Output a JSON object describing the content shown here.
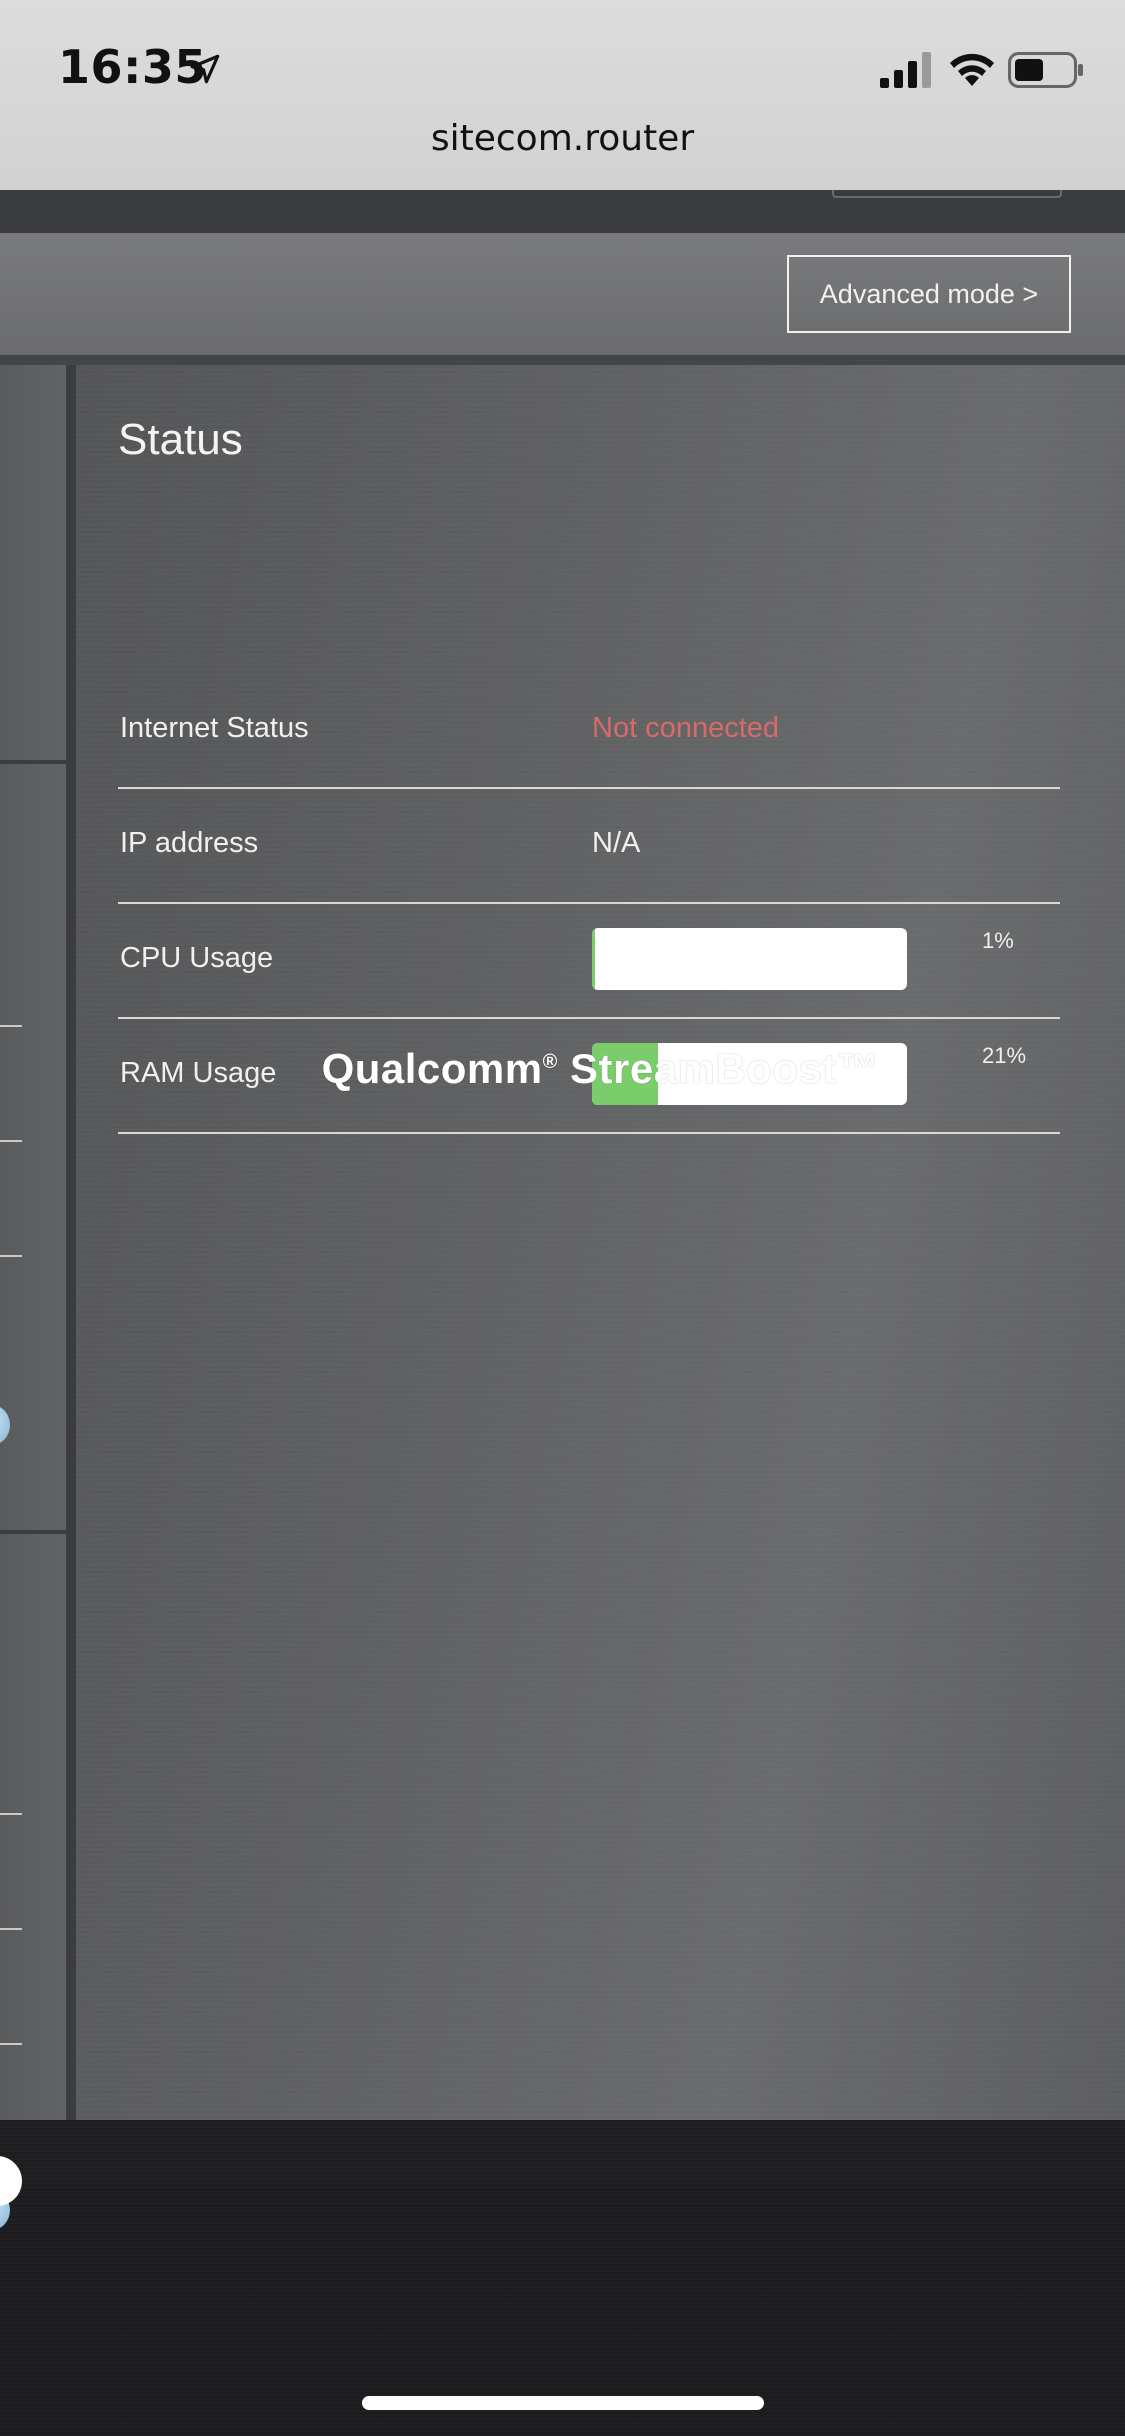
{
  "status_bar": {
    "time": "16:35",
    "icons": [
      "location-arrow-icon",
      "cellular-signal-icon",
      "wifi-icon",
      "battery-icon"
    ]
  },
  "browser": {
    "url": "sitecom.router"
  },
  "header": {
    "advanced_mode_label": "Advanced mode >"
  },
  "status": {
    "title": "Status",
    "rows": [
      {
        "label": "Internet Status",
        "value": "Not connected"
      },
      {
        "label": "IP address",
        "value": "N/A"
      },
      {
        "label": "CPU Usage",
        "percent_label": "1%",
        "percent": 1
      },
      {
        "label": "RAM Usage",
        "percent_label": "21%",
        "percent": 21
      }
    ]
  },
  "branding": {
    "name_part1": "Qualcomm",
    "reg_mark": "®",
    "name_part2": " StreamBoost™"
  },
  "colors": {
    "error_text": "#d96a6a",
    "usage_fill": "#7acd6a"
  }
}
